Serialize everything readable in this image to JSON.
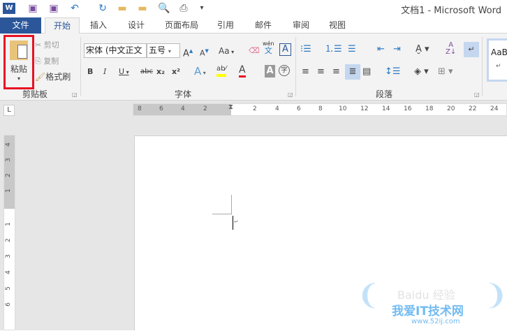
{
  "window": {
    "title": "文档1 - Microsoft Word"
  },
  "quick_access": {
    "more": "▾"
  },
  "tabs": [
    {
      "label": "文件"
    },
    {
      "label": "开始"
    },
    {
      "label": "插入"
    },
    {
      "label": "设计"
    },
    {
      "label": "页面布局"
    },
    {
      "label": "引用"
    },
    {
      "label": "邮件"
    },
    {
      "label": "审阅"
    },
    {
      "label": "视图"
    }
  ],
  "clipboard": {
    "paste": "粘贴",
    "cut": "剪切",
    "copy": "复制",
    "format_painter": "格式刷",
    "group_label": "剪贴板"
  },
  "font": {
    "font_name": "宋体 (中文正文",
    "font_size": "五号",
    "change_case": "Aa",
    "phonetic_top": "wén",
    "phonetic_bottom": "文",
    "bold": "B",
    "italic": "I",
    "underline": "U",
    "strike": "abc",
    "subscript": "x₂",
    "superscript": "x²",
    "effects": "A",
    "font_color": "A",
    "char_shading": "A",
    "enclose": "字",
    "char_border": "A",
    "group_label": "字体"
  },
  "paragraph": {
    "group_label": "段落",
    "show_marks": "↵"
  },
  "styles": {
    "preview": "AaB",
    "mark": "↵"
  },
  "ruler": {
    "corner": "L",
    "h_left": [
      "8",
      "6",
      "4",
      "2"
    ],
    "h_right": [
      "2",
      "4",
      "6",
      "8",
      "10",
      "12",
      "14",
      "16",
      "18",
      "20",
      "22",
      "24"
    ],
    "v_top": [
      "4",
      "3",
      "2",
      "1"
    ],
    "v_bottom": [
      "1",
      "2",
      "3",
      "4",
      "5",
      "6"
    ]
  },
  "document": {
    "para_mark": "↵"
  },
  "watermark": {
    "text": "我爱IT技术网",
    "url": "www.52ij.com",
    "brand": "Baidu 经验"
  },
  "colors": {
    "file_tab": "#2b579a",
    "highlight_box": "#e81123",
    "accent": "#2b579a"
  }
}
